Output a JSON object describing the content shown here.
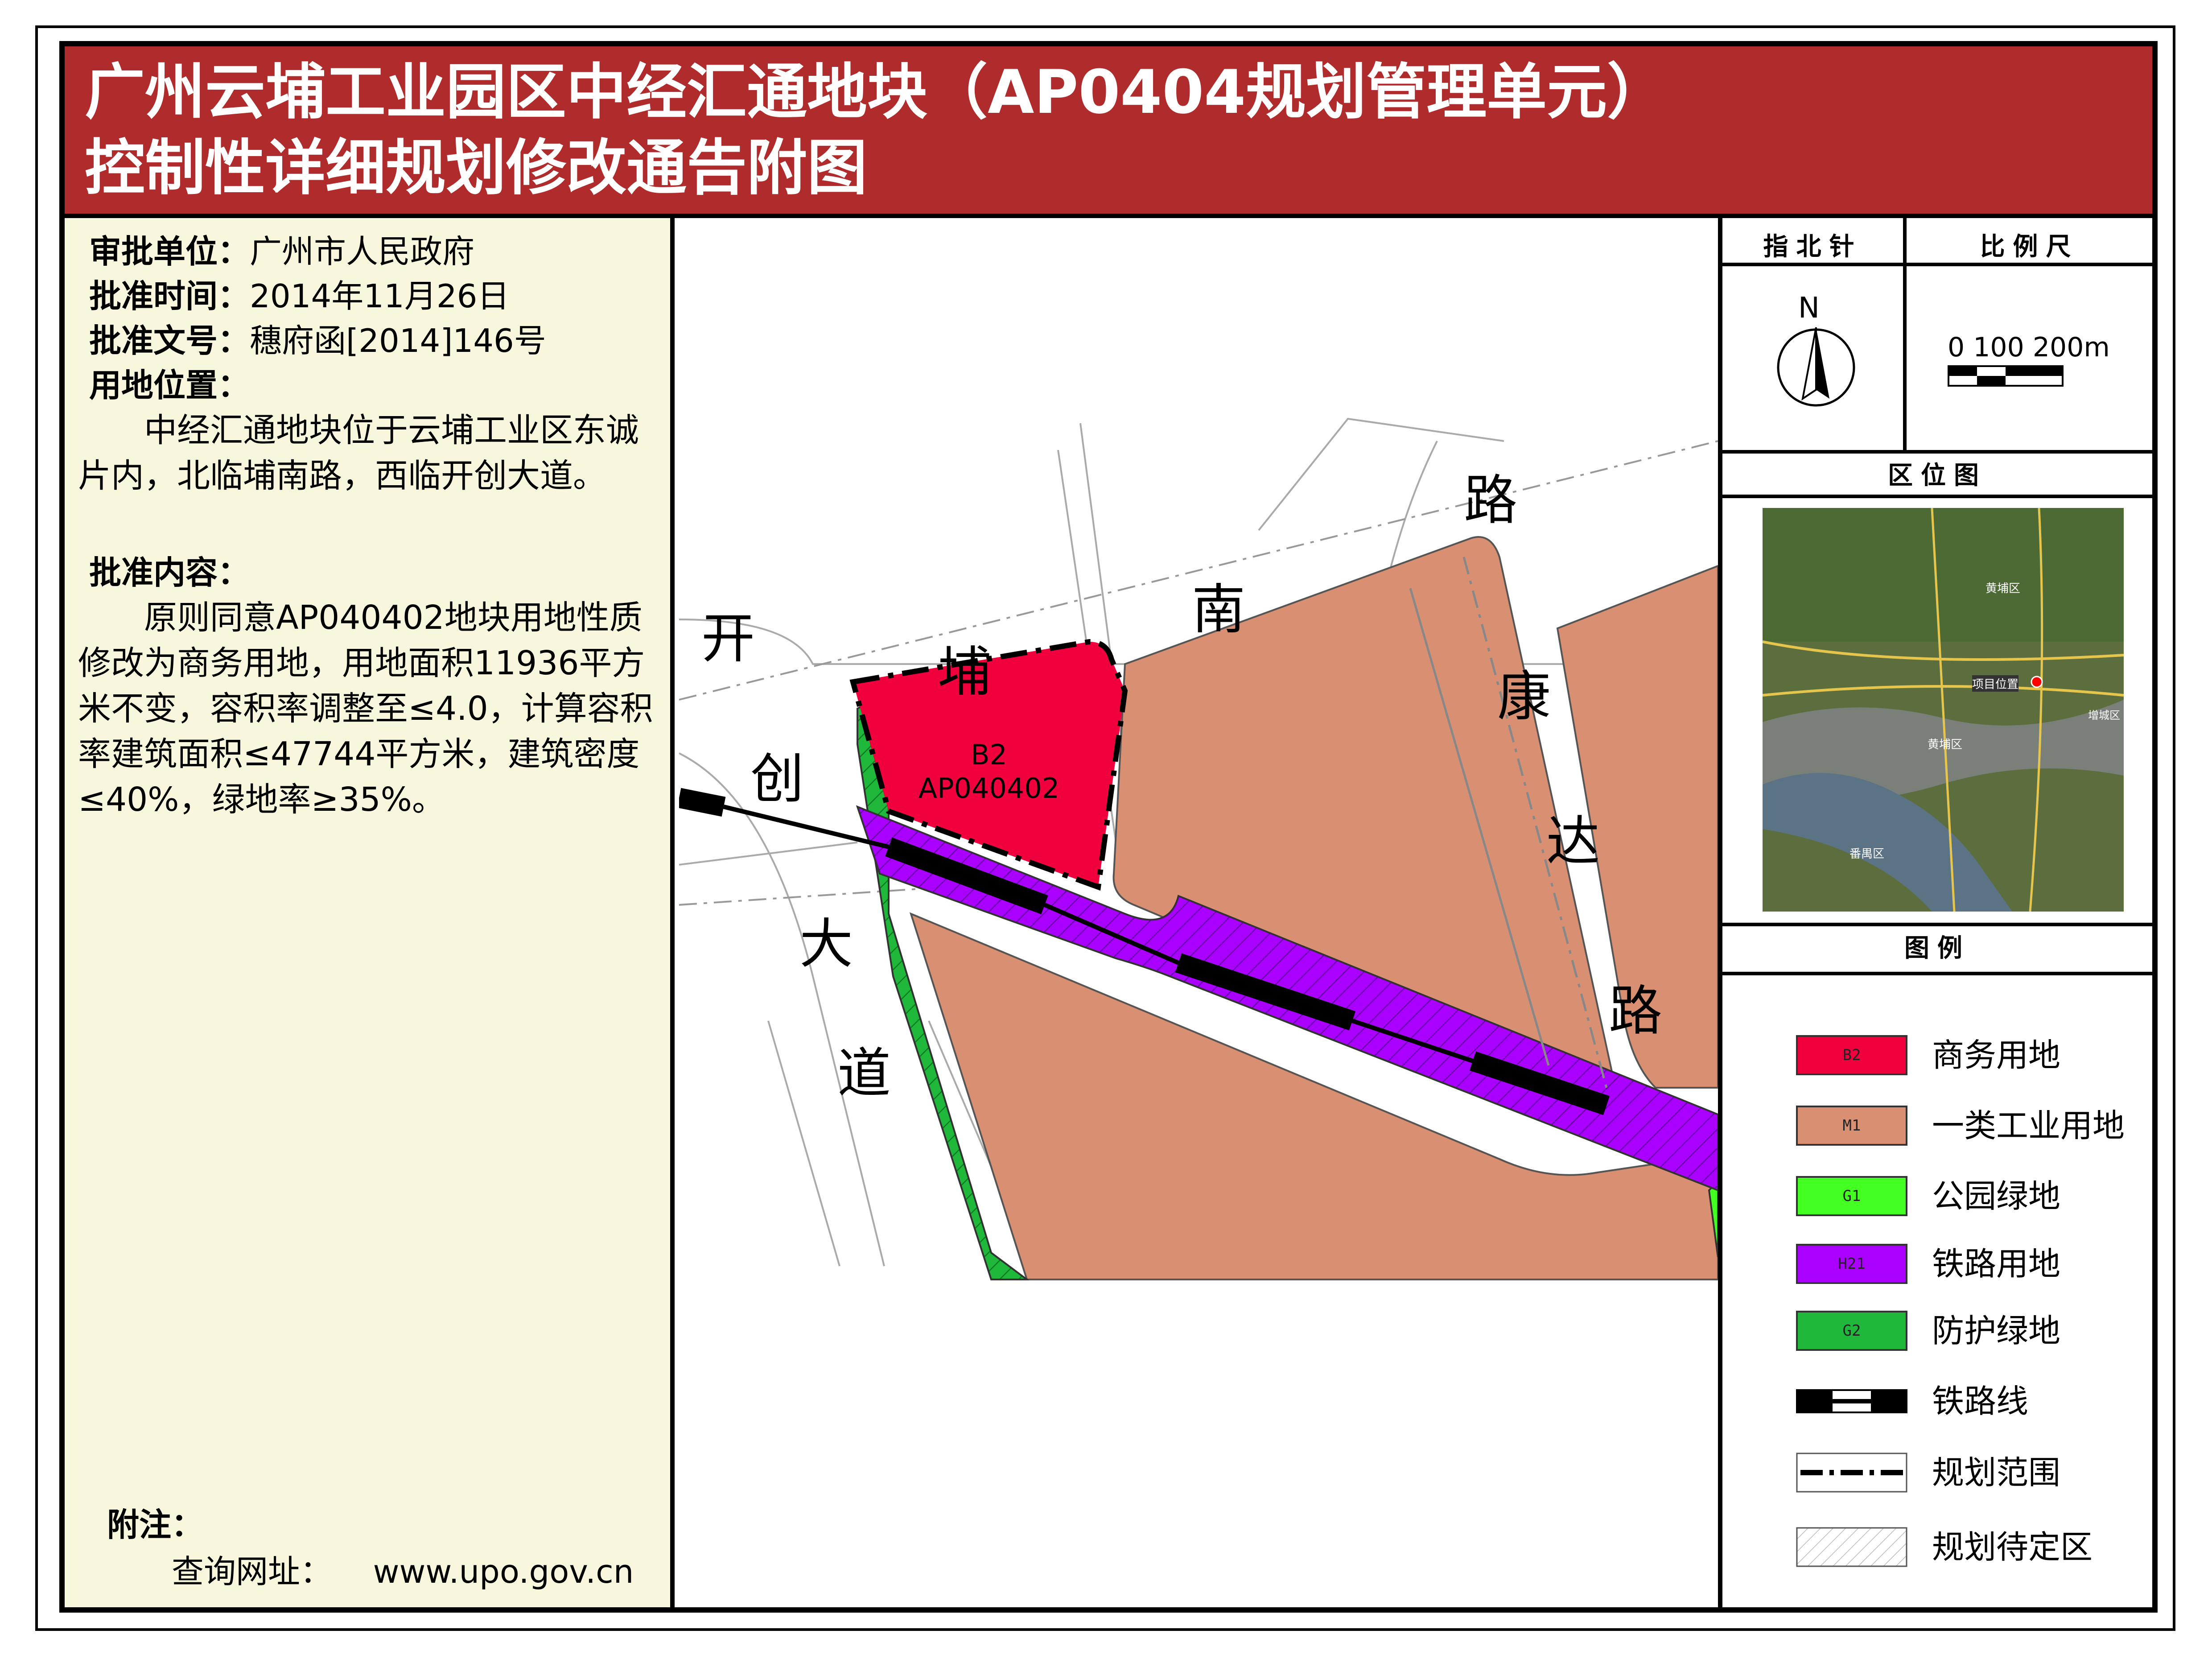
{
  "title": {
    "line1": "广州云埔工业园区中经汇通地块（AP0404规划管理单元）",
    "line2": "控制性详细规划修改通告附图"
  },
  "info": {
    "approver_label": "审批单位：",
    "approver_value": "广州市人民政府",
    "date_label": "批准时间：",
    "date_value": "2014年11月26日",
    "doc_label": "批准文号：",
    "doc_value": "穗府函[2014]146号",
    "location_label": "用地位置：",
    "location_text": "　　中经汇通地块位于云埔工业区东诚片内，北临埔南路，西临开创大道。",
    "content_label": "批准内容：",
    "content_text": "　　原则同意AP040402地块用地性质修改为商务用地，用地面积11936平方米不变，容积率调整至≤4.0，计算容积率建筑面积≤47744平方米，建筑密度≤40%，绿地率≥35%。",
    "note_label": "附注：",
    "url_label": "查询网址：",
    "url_value": "www.upo.gov.cn"
  },
  "map": {
    "parcel_code": "B2",
    "parcel_id": "AP040402",
    "roads": {
      "west_road": [
        "开",
        "创",
        "大",
        "道"
      ],
      "north_road": [
        "埔",
        "南",
        "路"
      ],
      "east_road": [
        "康",
        "达",
        "路"
      ]
    }
  },
  "north_arrow": {
    "header": "指北针",
    "letter": "N"
  },
  "scale": {
    "header": "比例尺",
    "text": "0 100 200m"
  },
  "location_map": {
    "header": "区位图",
    "labels": [
      "黄埔区",
      "项目位置",
      "增城区",
      "黄埔区",
      "番禺区"
    ]
  },
  "legend": {
    "header": "图例",
    "items": [
      {
        "code": "B2",
        "label": "商务用地",
        "color": "#f0003c"
      },
      {
        "code": "M1",
        "label": "一类工业用地",
        "color": "#d99072"
      },
      {
        "code": "G1",
        "label": "公园绿地",
        "color": "#44ff22"
      },
      {
        "code": "H21",
        "label": "铁路用地",
        "color": "#aa00ff"
      },
      {
        "code": "G2",
        "label": "防护绿地",
        "color": "#1fb83a"
      },
      {
        "code": "",
        "label": "铁路线",
        "color": "#000000"
      },
      {
        "code": "",
        "label": "规划范围",
        "color": "#000000"
      },
      {
        "code": "",
        "label": "规划待定区",
        "color": "#ffffff"
      }
    ]
  }
}
